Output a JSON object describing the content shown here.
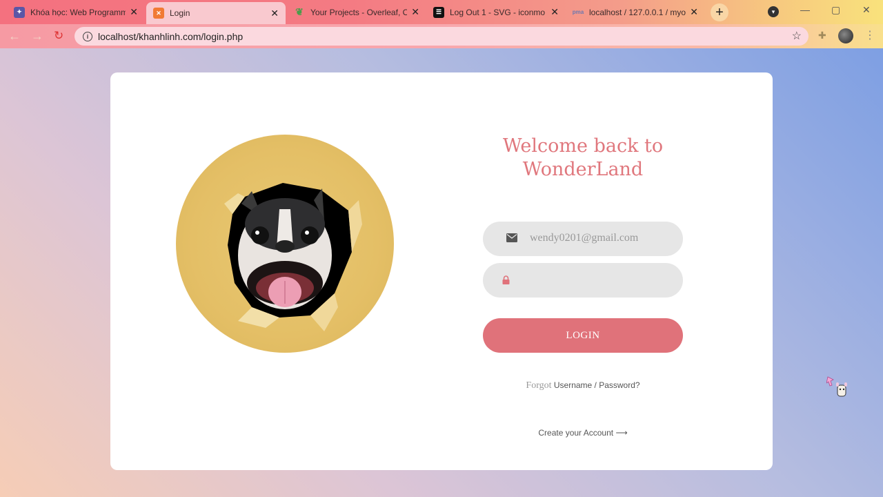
{
  "browser": {
    "tabs": [
      {
        "title": "Khóa học: Web Programm",
        "favicon": "university-icon",
        "active": false
      },
      {
        "title": "Login",
        "favicon": "xampp-icon",
        "active": true
      },
      {
        "title": "Your Projects - Overleaf, O",
        "favicon": "overleaf-icon",
        "active": false
      },
      {
        "title": "Log Out 1 - SVG - iconmo",
        "favicon": "iconmonstr-icon",
        "active": false
      },
      {
        "title": "localhost / 127.0.0.1 / myo",
        "favicon": "phpmyadmin-icon",
        "active": false
      }
    ],
    "close_glyph": "✕",
    "new_tab": "+",
    "url": "localhost/khanhlinh.com/login.php"
  },
  "login": {
    "welcome_line1": "Welcome back to",
    "welcome_line2": "WonderLand",
    "email_value": "wendy0201@gmail.com",
    "password_value": "",
    "login_button": "LOGIN",
    "forgot_prefix": "Forgot",
    "forgot_link": "Username / Password?",
    "create_account": "Create your Account",
    "create_arrow": "⟶"
  },
  "colors": {
    "accent": "#e0727a",
    "input_bg": "#e6e6e6",
    "card_bg": "#ffffff",
    "dog_circle": "#e4bf66"
  }
}
